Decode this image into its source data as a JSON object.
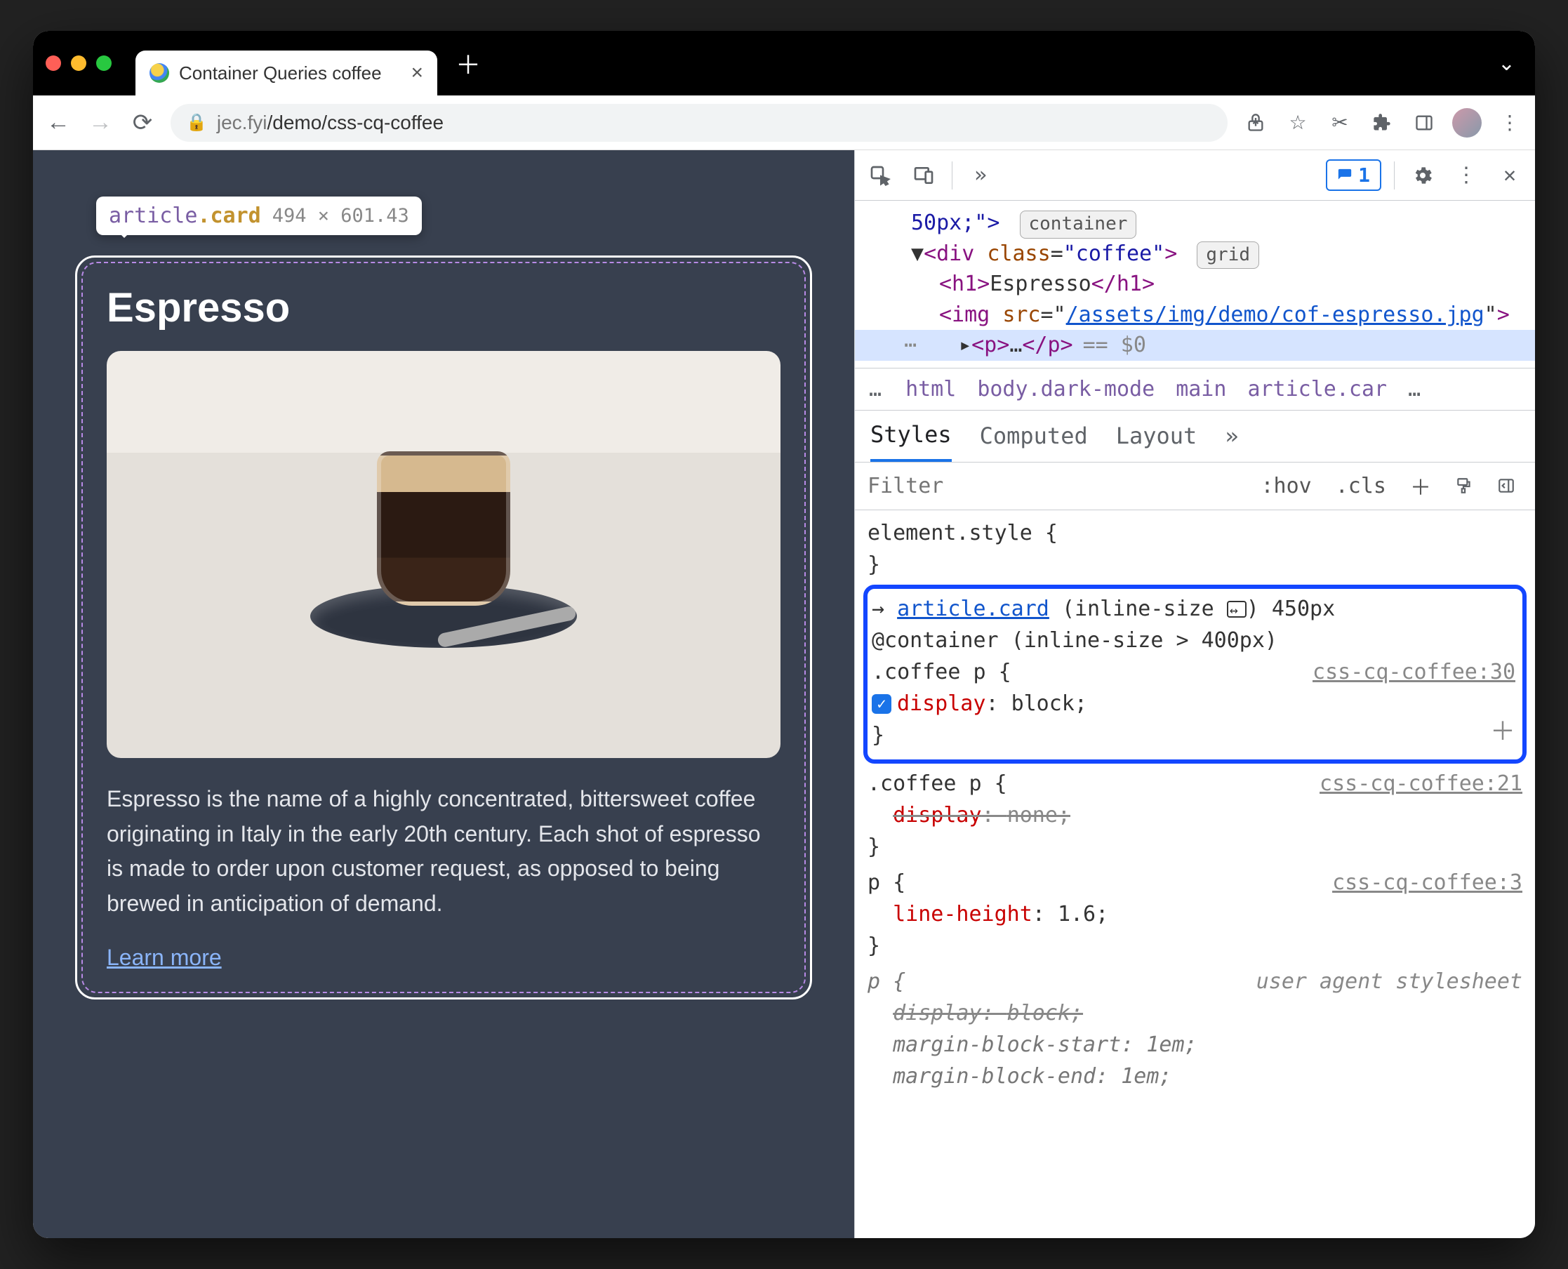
{
  "browser": {
    "tab_title": "Container Queries coffee",
    "url_host": "jec.fyi",
    "url_path": "/demo/css-cq-coffee"
  },
  "inspect_tooltip": {
    "tag": "article",
    "class": ".card",
    "dimensions": "494 × 601.43"
  },
  "page": {
    "heading": "Espresso",
    "paragraph": "Espresso is the name of a highly concentrated, bittersweet coffee originating in Italy in the early 20th century. Each shot of espresso is made to order upon customer request, as opposed to being brewed in anticipation of demand.",
    "link": "Learn more"
  },
  "devtools": {
    "issues_count": "1",
    "elements": {
      "style_frag": "50px;\">",
      "badge_container": "container",
      "div_open": "<div class=\"coffee\">",
      "badge_grid": "grid",
      "h1": "<h1>Espresso</h1>",
      "img_prefix": "<img src=\"",
      "img_src": "/assets/img/demo/cof-espresso.jpg",
      "img_suffix": "\">",
      "p_sel": "<p>…</p>",
      "eq0": "== $0"
    },
    "crumbs": [
      "html",
      "body.dark-mode",
      "main",
      "article.car"
    ],
    "styles_tabs": [
      "Styles",
      "Computed",
      "Layout"
    ],
    "filter_placeholder": "Filter",
    "filter_buttons": [
      ":hov",
      ".cls"
    ],
    "rules": {
      "element_style": "element.style {",
      "highlighted": {
        "arrow": "→",
        "container_link": "article.card",
        "container_dim": "(inline-size",
        "container_px": ") 450px",
        "at_rule": "@container (inline-size > 400px)",
        "selector": ".coffee p {",
        "source": "css-cq-coffee:30",
        "prop": "display",
        "val": "block;"
      },
      "overridden": {
        "selector": ".coffee p {",
        "source": "css-cq-coffee:21",
        "prop": "display",
        "val": "none;"
      },
      "p_rule": {
        "selector": "p {",
        "source": "css-cq-coffee:3",
        "prop": "line-height",
        "val": "1.6;"
      },
      "ua": {
        "selector": "p {",
        "source": "user agent stylesheet",
        "l1p": "display",
        "l1v": "block;",
        "l2p": "margin-block-start",
        "l2v": "1em;",
        "l3p": "margin-block-end",
        "l3v": "1em;"
      }
    }
  }
}
